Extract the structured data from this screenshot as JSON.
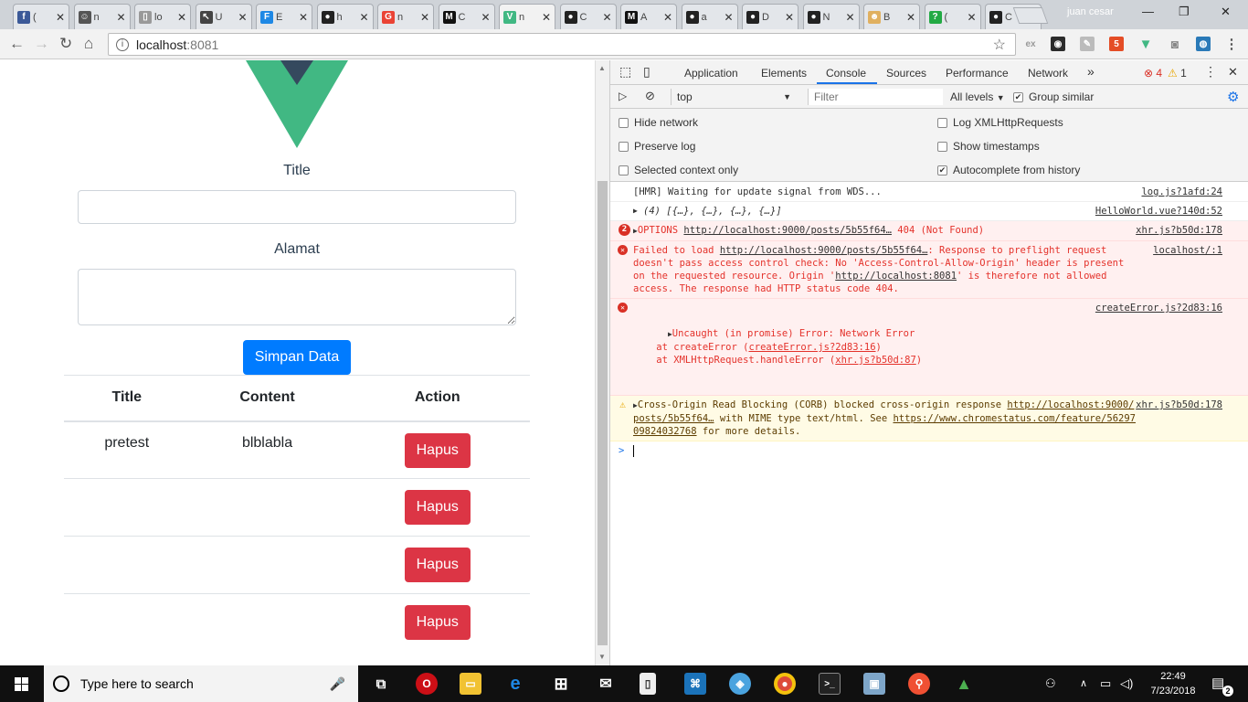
{
  "browser": {
    "tabs": [
      {
        "icon": "facebook-icon",
        "title": "(",
        "color": "#3b5998",
        "glyph": "f"
      },
      {
        "icon": "robot-icon",
        "title": "n",
        "color": "#555555",
        "glyph": "☺"
      },
      {
        "icon": "document-icon",
        "title": "lo",
        "color": "#999999",
        "glyph": "▯"
      },
      {
        "icon": "cursor-icon",
        "title": "U",
        "color": "#444444",
        "glyph": "↖"
      },
      {
        "icon": "flask-icon",
        "title": "E",
        "color": "#1e88e5",
        "glyph": "F"
      },
      {
        "icon": "github-icon",
        "title": "h",
        "color": "#222222",
        "glyph": "●"
      },
      {
        "icon": "google-icon",
        "title": "n",
        "color": "#ea4335",
        "glyph": "G"
      },
      {
        "icon": "medium-icon",
        "title": "C",
        "color": "#111111",
        "glyph": "M"
      },
      {
        "icon": "vue-icon",
        "title": "n",
        "color": "#41b883",
        "glyph": "V"
      },
      {
        "icon": "github-icon",
        "title": "C",
        "color": "#222222",
        "glyph": "●"
      },
      {
        "icon": "medium-icon",
        "title": "A",
        "color": "#111111",
        "glyph": "M"
      },
      {
        "icon": "github-icon",
        "title": "a",
        "color": "#222222",
        "glyph": "●"
      },
      {
        "icon": "github-icon",
        "title": "D",
        "color": "#222222",
        "glyph": "●"
      },
      {
        "icon": "github-icon",
        "title": "N",
        "color": "#222222",
        "glyph": "●"
      },
      {
        "icon": "avatar-icon",
        "title": "B",
        "color": "#e0b060",
        "glyph": "☻"
      },
      {
        "icon": "question-icon",
        "title": "(",
        "color": "#22aa44",
        "glyph": "?"
      },
      {
        "icon": "github-icon",
        "title": "C",
        "color": "#222222",
        "glyph": "●"
      }
    ],
    "active_tab": 8,
    "profile_name": "juan cesar",
    "url_host": "localhost",
    "url_port": ":8081"
  },
  "page": {
    "title_label": "Title",
    "alamat_label": "Alamat",
    "title_value": "",
    "alamat_value": "",
    "save_button": "Simpan Data",
    "table": {
      "headers": [
        "Title",
        "Content",
        "Action"
      ],
      "rows": [
        {
          "title": "pretest",
          "content": "blblabla",
          "action": "Hapus"
        },
        {
          "title": "",
          "content": "",
          "action": "Hapus"
        },
        {
          "title": "",
          "content": "",
          "action": "Hapus"
        },
        {
          "title": "",
          "content": "",
          "action": "Hapus"
        }
      ]
    },
    "colors": {
      "primary": "#007bff",
      "danger": "#dc3545",
      "vue_green": "#41b883",
      "vue_dark": "#35495e"
    }
  },
  "devtools": {
    "tabs": [
      "Application",
      "Elements",
      "Console",
      "Sources",
      "Performance",
      "Network"
    ],
    "active_tab": "Console",
    "more_tabs": "»",
    "error_count": "4",
    "warning_count": "1",
    "context": "top",
    "filter_placeholder": "Filter",
    "levels": "All levels",
    "group_similar": "Group similar",
    "settings": {
      "hide_network": "Hide network",
      "preserve_log": "Preserve log",
      "selected_context_only": "Selected context only",
      "log_xhr": "Log XMLHttpRequests",
      "show_timestamps": "Show timestamps",
      "autocomplete": "Autocomplete from history"
    },
    "messages": {
      "m1": {
        "text": "[HMR] Waiting for update signal from WDS...",
        "src": "log.js?1afd:24"
      },
      "m2": {
        "text": "(4) [{…}, {…}, {…}, {…}]",
        "src": "HelloWorld.vue?140d:52"
      },
      "m3": {
        "count": "2",
        "prefix": "OPTIONS ",
        "url": "http://localhost:9000/posts/5b55f64…",
        "suffix": " 404 (Not Found)",
        "src": "xhr.js?b50d:178"
      },
      "m4": {
        "p1": "Failed to load ",
        "url1": "http://localhost:9000/posts/5b55f64…",
        "p2": ": Response to preflight request doesn't pass access control check: No 'Access-Control-Allow-Origin' header is present on the requested resource. Origin '",
        "url2": "http://localhost:8081",
        "p3": "' is therefore not allowed access. The response had HTTP status code 404.",
        "src": "localhost/:1"
      },
      "m5": {
        "line1": "Uncaught (in promise) Error: Network Error",
        "line2a": "    at createError (",
        "line2link": "createError.js?2d83:16",
        "line2b": ")",
        "line3a": "    at XMLHttpRequest.handleError (",
        "line3link": "xhr.js?b50d:87",
        "line3b": ")",
        "src": "createError.js?2d83:16"
      },
      "m6": {
        "p1": "Cross-Origin Read Blocking (CORB) blocked cross-origin response ",
        "url1": "http://localhost:9000/posts/5b55f64…",
        "p2": " with MIME type text/html. See ",
        "url2": "https://www.chromestatus.com/feature/5629709824032768",
        "p3": " for more details.",
        "src": "xhr.js?b50d:178"
      }
    },
    "prompt": ">"
  },
  "taskbar": {
    "search_placeholder": "Type here to search",
    "time": "22:49",
    "date": "7/23/2018",
    "notifications": "2"
  }
}
